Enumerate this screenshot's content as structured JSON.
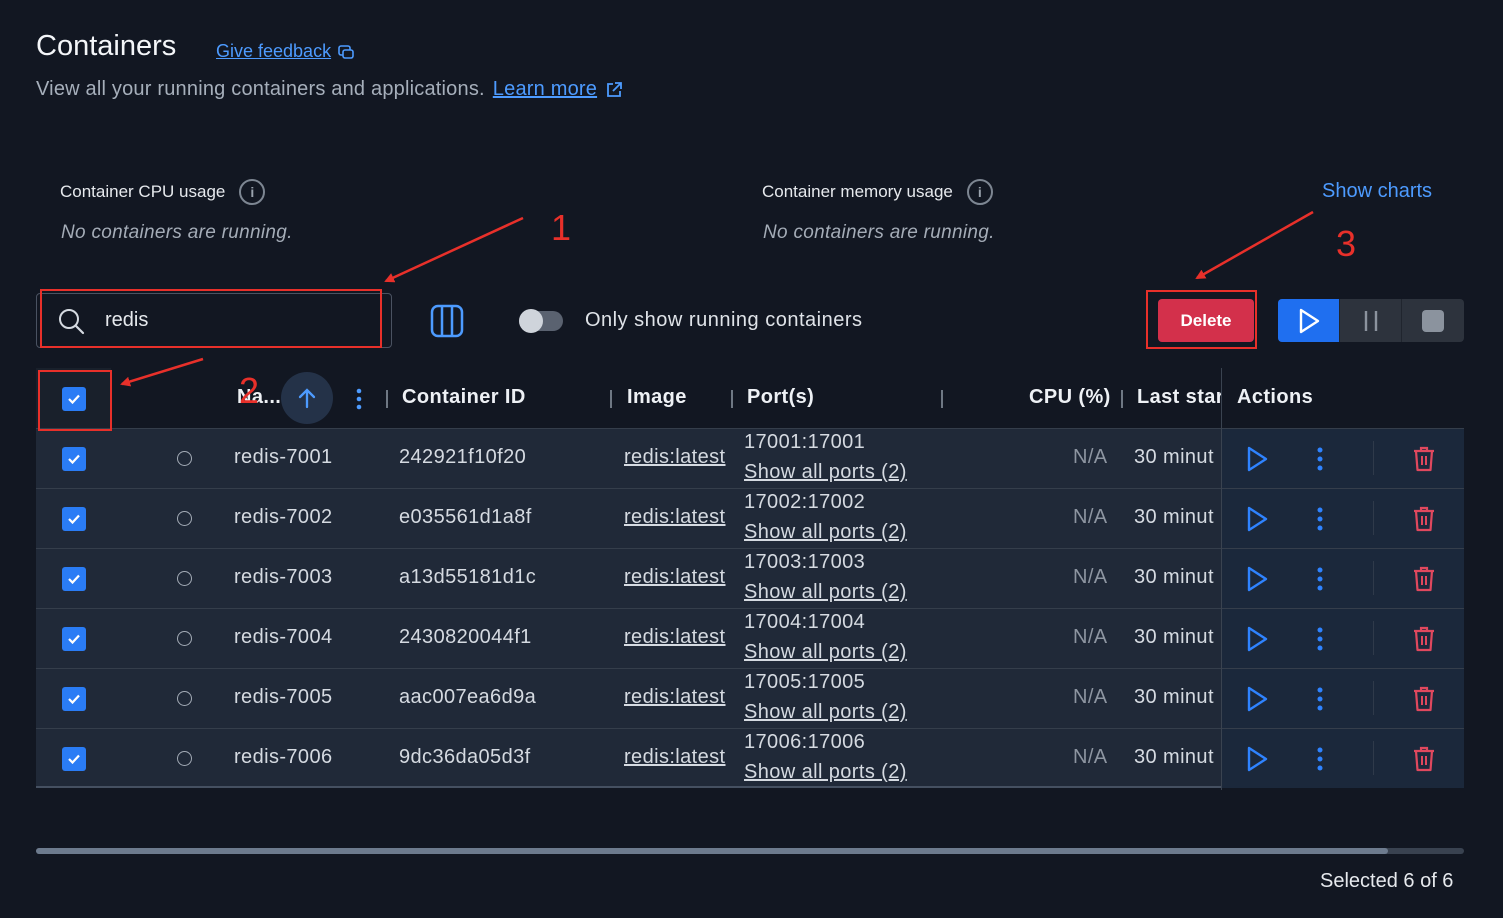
{
  "header": {
    "title": "Containers",
    "feedback_label": "Give feedback",
    "subtitle": "View all your running containers and applications.",
    "learn_more_label": "Learn more"
  },
  "stats": {
    "cpu_label": "Container CPU usage",
    "cpu_empty": "No containers are running.",
    "memory_label": "Container memory usage",
    "memory_empty": "No containers are running.",
    "show_charts_label": "Show charts"
  },
  "toolbar": {
    "search_value": "redis",
    "toggle_label": "Only show running containers",
    "toggle_on": false,
    "delete_label": "Delete"
  },
  "table": {
    "columns": {
      "name": "Na...",
      "container_id": "Container ID",
      "image": "Image",
      "ports": "Port(s)",
      "cpu": "CPU (%)",
      "last_started": "Last star",
      "actions": "Actions"
    },
    "rows": [
      {
        "name": "redis-7001",
        "id": "242921f10f20",
        "image": "redis:latest",
        "port": "17001:17001",
        "show_ports": "Show all ports (2)",
        "cpu": "N/A",
        "last_started": "30 minut"
      },
      {
        "name": "redis-7002",
        "id": "e035561d1a8f",
        "image": "redis:latest",
        "port": "17002:17002",
        "show_ports": "Show all ports (2)",
        "cpu": "N/A",
        "last_started": "30 minut"
      },
      {
        "name": "redis-7003",
        "id": "a13d55181d1c",
        "image": "redis:latest",
        "port": "17003:17003",
        "show_ports": "Show all ports (2)",
        "cpu": "N/A",
        "last_started": "30 minut"
      },
      {
        "name": "redis-7004",
        "id": "2430820044f1",
        "image": "redis:latest",
        "port": "17004:17004",
        "show_ports": "Show all ports (2)",
        "cpu": "N/A",
        "last_started": "30 minut"
      },
      {
        "name": "redis-7005",
        "id": "aac007ea6d9a",
        "image": "redis:latest",
        "port": "17005:17005",
        "show_ports": "Show all ports (2)",
        "cpu": "N/A",
        "last_started": "30 minut"
      },
      {
        "name": "redis-7006",
        "id": "9dc36da05d3f",
        "image": "redis:latest",
        "port": "17006:17006",
        "show_ports": "Show all ports (2)",
        "cpu": "N/A",
        "last_started": "30 minut"
      }
    ]
  },
  "footer": {
    "selected_text": "Selected 6 of 6"
  },
  "annotations": {
    "one": "1",
    "two": "2",
    "three": "3"
  },
  "colors": {
    "background": "#121722",
    "accent": "#1f6ff0",
    "link": "#4d9bff",
    "danger": "#d3304b",
    "annotation": "#e8302a"
  }
}
